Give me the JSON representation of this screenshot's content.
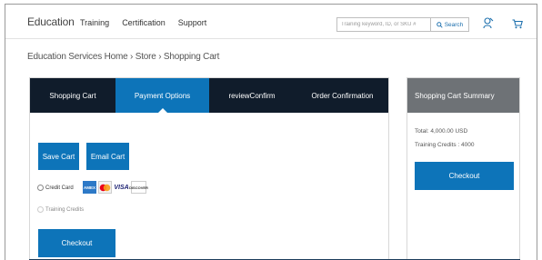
{
  "header": {
    "brand": "Education",
    "nav": [
      "Training",
      "Certification",
      "Support"
    ],
    "search": {
      "placeholder": "Training keyword, ID, or SKU #",
      "button_label": "Search"
    }
  },
  "breadcrumb": "Education Services Home › Store › Shopping Cart",
  "steps": {
    "active": "Payment Options",
    "items": [
      "Shopping Cart",
      "Payment Options",
      "reviewConfirm",
      "Order Confirmation"
    ]
  },
  "cart_actions": {
    "save_label": "Save Cart",
    "email_label": "Email Cart"
  },
  "payment": {
    "credit_card_label": "Credit Card",
    "training_credits_label": "Training Credits",
    "cards": [
      "AMEX",
      "MC",
      "VISA",
      "DISCOVER"
    ]
  },
  "checkout_label": "Checkout",
  "summary": {
    "title": "Shopping Cart Summary",
    "total": "Total: 4,000.00 USD",
    "credits": "Training Credits : 4000",
    "checkout_label": "Checkout"
  },
  "colors": {
    "accent": "#0d74b9",
    "dark_nav": "#101c2b",
    "summary_header": "#6e7276"
  }
}
